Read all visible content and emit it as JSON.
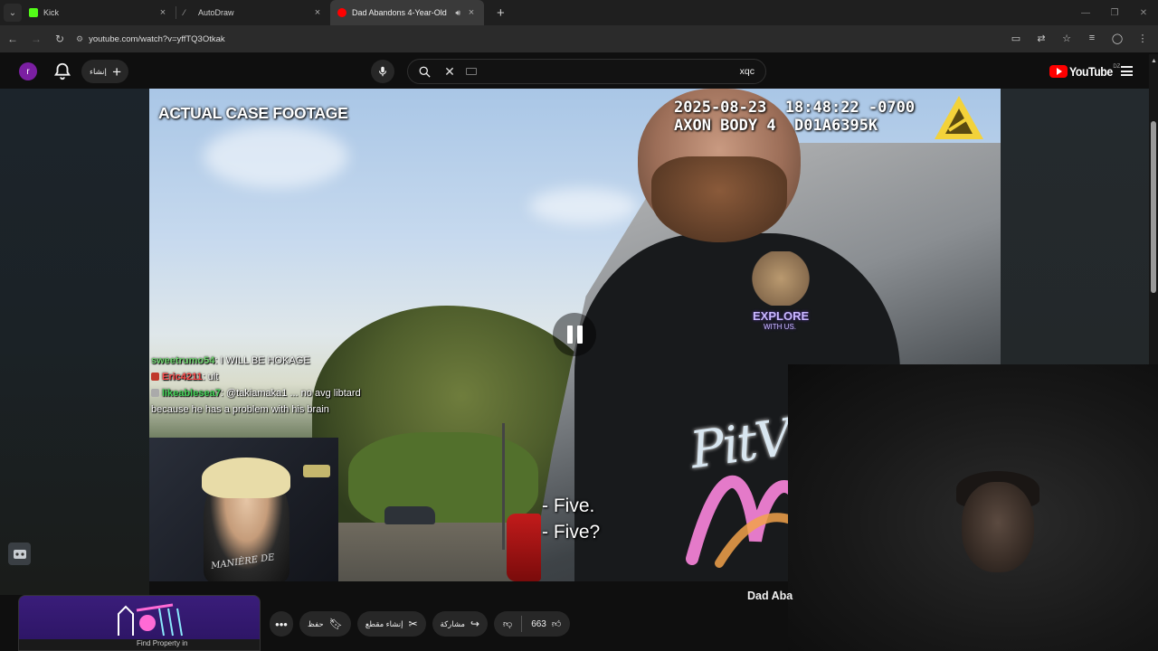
{
  "browser": {
    "tabs": [
      {
        "title": "Kick",
        "favicon_color": "#53fc18",
        "active": false
      },
      {
        "title": "AutoDraw",
        "favicon_color": "#9e9e9e",
        "active": false
      },
      {
        "title": "Dad Abandons 4-Year-Old",
        "favicon_color": "#ff0000",
        "active": true,
        "audio_icon": "speaker-icon"
      }
    ],
    "url": "youtube.com/watch?v=yffTQ3Otkak"
  },
  "masthead": {
    "avatar_letter": "r",
    "create_label": "إنشاء",
    "search_query": "xqc",
    "logo_text": "YouTube",
    "logo_country": "DZ"
  },
  "video": {
    "title_overlay": "ACTUAL CASE FOOTAGE",
    "stamp_line1": "2025-08-23  18:48:22 -0700",
    "stamp_line2": "AXON BODY 4  D01A6395K",
    "shirt_logo_main": "EXPLORE",
    "shirt_logo_sub": "WITH US.",
    "shirt_brand": "PitVi",
    "subtitle_line1": "- Five.",
    "subtitle_line2": "- Five?",
    "state": "paused"
  },
  "chat": [
    {
      "user": "sweetrumo54",
      "color": "#6fd36f",
      "message": "I WILL BE HOKAGE"
    },
    {
      "user": "Eric4211",
      "color": "#ff4d4d",
      "message": "ult"
    },
    {
      "user": "likeablesea7",
      "color": "#45d45a",
      "message": "@takiamaka1 ... no avg libtard because he has a problem with his brain"
    }
  ],
  "webcam": {
    "shirt_text": "MANIÈRE DE"
  },
  "below": {
    "title_snippet": "Dad Aba",
    "save_label": "حفظ",
    "clip_label": "إنشاء مقطع",
    "share_label": "مشاركة",
    "like_count": "663",
    "ad_label": "Find Property in"
  },
  "colors": {
    "background": "#0f0f0f",
    "pill": "#272727",
    "youtube_red": "#ff0000",
    "avatar": "#7b1fa2"
  }
}
